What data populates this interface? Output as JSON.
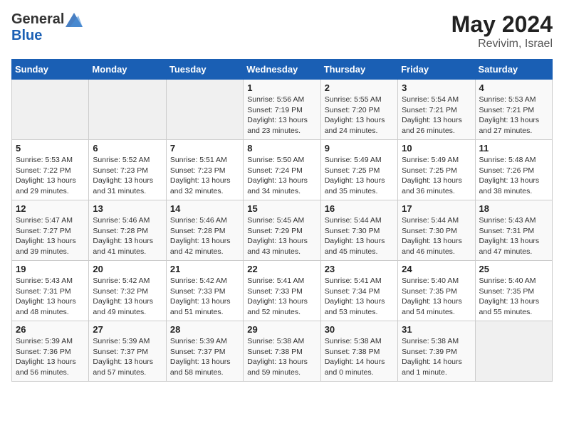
{
  "header": {
    "logo_general": "General",
    "logo_blue": "Blue",
    "month_year": "May 2024",
    "location": "Revivim, Israel"
  },
  "weekdays": [
    "Sunday",
    "Monday",
    "Tuesday",
    "Wednesday",
    "Thursday",
    "Friday",
    "Saturday"
  ],
  "weeks": [
    [
      {
        "day": "",
        "sunrise": "",
        "sunset": "",
        "daylight": ""
      },
      {
        "day": "",
        "sunrise": "",
        "sunset": "",
        "daylight": ""
      },
      {
        "day": "",
        "sunrise": "",
        "sunset": "",
        "daylight": ""
      },
      {
        "day": "1",
        "sunrise": "Sunrise: 5:56 AM",
        "sunset": "Sunset: 7:19 PM",
        "daylight": "Daylight: 13 hours and 23 minutes."
      },
      {
        "day": "2",
        "sunrise": "Sunrise: 5:55 AM",
        "sunset": "Sunset: 7:20 PM",
        "daylight": "Daylight: 13 hours and 24 minutes."
      },
      {
        "day": "3",
        "sunrise": "Sunrise: 5:54 AM",
        "sunset": "Sunset: 7:21 PM",
        "daylight": "Daylight: 13 hours and 26 minutes."
      },
      {
        "day": "4",
        "sunrise": "Sunrise: 5:53 AM",
        "sunset": "Sunset: 7:21 PM",
        "daylight": "Daylight: 13 hours and 27 minutes."
      }
    ],
    [
      {
        "day": "5",
        "sunrise": "Sunrise: 5:53 AM",
        "sunset": "Sunset: 7:22 PM",
        "daylight": "Daylight: 13 hours and 29 minutes."
      },
      {
        "day": "6",
        "sunrise": "Sunrise: 5:52 AM",
        "sunset": "Sunset: 7:23 PM",
        "daylight": "Daylight: 13 hours and 31 minutes."
      },
      {
        "day": "7",
        "sunrise": "Sunrise: 5:51 AM",
        "sunset": "Sunset: 7:23 PM",
        "daylight": "Daylight: 13 hours and 32 minutes."
      },
      {
        "day": "8",
        "sunrise": "Sunrise: 5:50 AM",
        "sunset": "Sunset: 7:24 PM",
        "daylight": "Daylight: 13 hours and 34 minutes."
      },
      {
        "day": "9",
        "sunrise": "Sunrise: 5:49 AM",
        "sunset": "Sunset: 7:25 PM",
        "daylight": "Daylight: 13 hours and 35 minutes."
      },
      {
        "day": "10",
        "sunrise": "Sunrise: 5:49 AM",
        "sunset": "Sunset: 7:25 PM",
        "daylight": "Daylight: 13 hours and 36 minutes."
      },
      {
        "day": "11",
        "sunrise": "Sunrise: 5:48 AM",
        "sunset": "Sunset: 7:26 PM",
        "daylight": "Daylight: 13 hours and 38 minutes."
      }
    ],
    [
      {
        "day": "12",
        "sunrise": "Sunrise: 5:47 AM",
        "sunset": "Sunset: 7:27 PM",
        "daylight": "Daylight: 13 hours and 39 minutes."
      },
      {
        "day": "13",
        "sunrise": "Sunrise: 5:46 AM",
        "sunset": "Sunset: 7:28 PM",
        "daylight": "Daylight: 13 hours and 41 minutes."
      },
      {
        "day": "14",
        "sunrise": "Sunrise: 5:46 AM",
        "sunset": "Sunset: 7:28 PM",
        "daylight": "Daylight: 13 hours and 42 minutes."
      },
      {
        "day": "15",
        "sunrise": "Sunrise: 5:45 AM",
        "sunset": "Sunset: 7:29 PM",
        "daylight": "Daylight: 13 hours and 43 minutes."
      },
      {
        "day": "16",
        "sunrise": "Sunrise: 5:44 AM",
        "sunset": "Sunset: 7:30 PM",
        "daylight": "Daylight: 13 hours and 45 minutes."
      },
      {
        "day": "17",
        "sunrise": "Sunrise: 5:44 AM",
        "sunset": "Sunset: 7:30 PM",
        "daylight": "Daylight: 13 hours and 46 minutes."
      },
      {
        "day": "18",
        "sunrise": "Sunrise: 5:43 AM",
        "sunset": "Sunset: 7:31 PM",
        "daylight": "Daylight: 13 hours and 47 minutes."
      }
    ],
    [
      {
        "day": "19",
        "sunrise": "Sunrise: 5:43 AM",
        "sunset": "Sunset: 7:31 PM",
        "daylight": "Daylight: 13 hours and 48 minutes."
      },
      {
        "day": "20",
        "sunrise": "Sunrise: 5:42 AM",
        "sunset": "Sunset: 7:32 PM",
        "daylight": "Daylight: 13 hours and 49 minutes."
      },
      {
        "day": "21",
        "sunrise": "Sunrise: 5:42 AM",
        "sunset": "Sunset: 7:33 PM",
        "daylight": "Daylight: 13 hours and 51 minutes."
      },
      {
        "day": "22",
        "sunrise": "Sunrise: 5:41 AM",
        "sunset": "Sunset: 7:33 PM",
        "daylight": "Daylight: 13 hours and 52 minutes."
      },
      {
        "day": "23",
        "sunrise": "Sunrise: 5:41 AM",
        "sunset": "Sunset: 7:34 PM",
        "daylight": "Daylight: 13 hours and 53 minutes."
      },
      {
        "day": "24",
        "sunrise": "Sunrise: 5:40 AM",
        "sunset": "Sunset: 7:35 PM",
        "daylight": "Daylight: 13 hours and 54 minutes."
      },
      {
        "day": "25",
        "sunrise": "Sunrise: 5:40 AM",
        "sunset": "Sunset: 7:35 PM",
        "daylight": "Daylight: 13 hours and 55 minutes."
      }
    ],
    [
      {
        "day": "26",
        "sunrise": "Sunrise: 5:39 AM",
        "sunset": "Sunset: 7:36 PM",
        "daylight": "Daylight: 13 hours and 56 minutes."
      },
      {
        "day": "27",
        "sunrise": "Sunrise: 5:39 AM",
        "sunset": "Sunset: 7:37 PM",
        "daylight": "Daylight: 13 hours and 57 minutes."
      },
      {
        "day": "28",
        "sunrise": "Sunrise: 5:39 AM",
        "sunset": "Sunset: 7:37 PM",
        "daylight": "Daylight: 13 hours and 58 minutes."
      },
      {
        "day": "29",
        "sunrise": "Sunrise: 5:38 AM",
        "sunset": "Sunset: 7:38 PM",
        "daylight": "Daylight: 13 hours and 59 minutes."
      },
      {
        "day": "30",
        "sunrise": "Sunrise: 5:38 AM",
        "sunset": "Sunset: 7:38 PM",
        "daylight": "Daylight: 14 hours and 0 minutes."
      },
      {
        "day": "31",
        "sunrise": "Sunrise: 5:38 AM",
        "sunset": "Sunset: 7:39 PM",
        "daylight": "Daylight: 14 hours and 1 minute."
      },
      {
        "day": "",
        "sunrise": "",
        "sunset": "",
        "daylight": ""
      }
    ]
  ]
}
